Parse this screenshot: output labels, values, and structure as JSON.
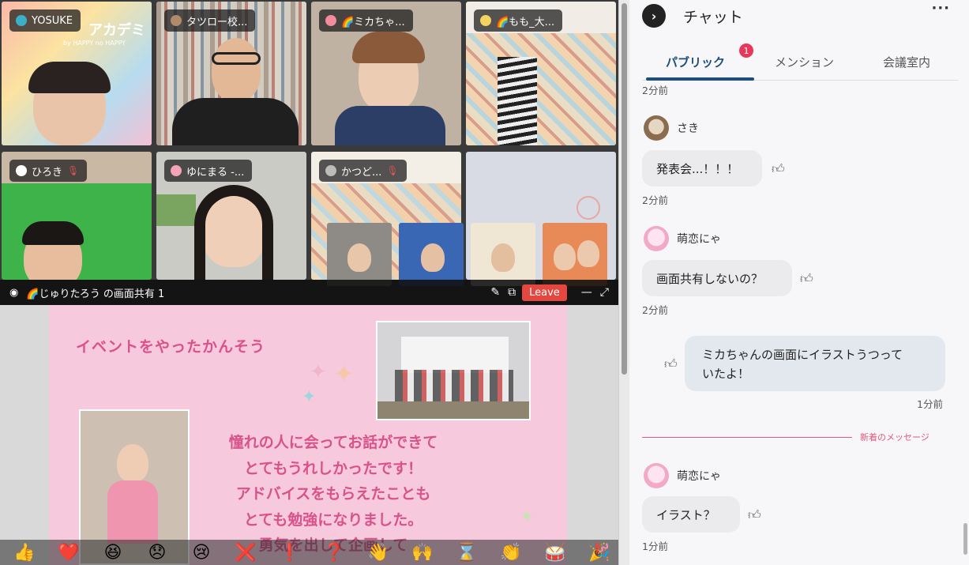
{
  "participants": [
    {
      "name": "YOSUKE",
      "muted": false
    },
    {
      "name": "タツロー校...",
      "muted": false
    },
    {
      "name": "🌈ミカちゃ...",
      "muted": false
    },
    {
      "name": "🌈もも_大...",
      "muted": false
    },
    {
      "name": "ひろき",
      "muted": true
    },
    {
      "name": "ゆにまる -...",
      "muted": false
    },
    {
      "name": "かつど...",
      "muted": true
    }
  ],
  "tile_background_text": {
    "logo": "アカデミ",
    "logo_sub": "by HAPPY no HAPPY"
  },
  "screen_share": {
    "title": "🌈じゅりたろう の画面共有 1",
    "leave_label": "Leave"
  },
  "slide": {
    "title": "イベントをやったかんそう",
    "lines": [
      "憧れの人に会ってお話ができて",
      "とてもうれしかったです！",
      "アドバイスをもらえたことも",
      "とても勉強になりました。",
      "勇気を出して企画して"
    ]
  },
  "reactions": [
    "👍",
    "❤️",
    "😆",
    "😞",
    "😢",
    "❌",
    "❗",
    "❓",
    "👋",
    "🙌",
    "⌛",
    "👏",
    "🥁",
    "🎉"
  ],
  "chat": {
    "title": "チャット",
    "more_label": "···",
    "tabs": [
      {
        "label": "パブリック",
        "badge": "1"
      },
      {
        "label": "メンション"
      },
      {
        "label": "会議室内"
      }
    ],
    "messages": [
      {
        "time": "2分前"
      },
      {
        "sender": "さき",
        "text": "発表会...！！！",
        "time": "2分前"
      },
      {
        "sender": "萌恋にゃ",
        "text": "画面共有しないの？",
        "time": "2分前"
      },
      {
        "own": true,
        "text_line1": "ミカちゃんの画面にイラストうつって",
        "text_line2": "いたよ！",
        "time": "1分前"
      },
      {
        "sender": "萌恋にゃ",
        "text": "イラスト？",
        "time": "1分前"
      }
    ],
    "new_messages_label": "新着のメッセージ"
  },
  "colors": {
    "accent": "#1d4e7b",
    "badge": "#e8385a",
    "leave": "#e4473f",
    "slide_bg": "#f6c9dd",
    "slide_text": "#d9528a"
  }
}
